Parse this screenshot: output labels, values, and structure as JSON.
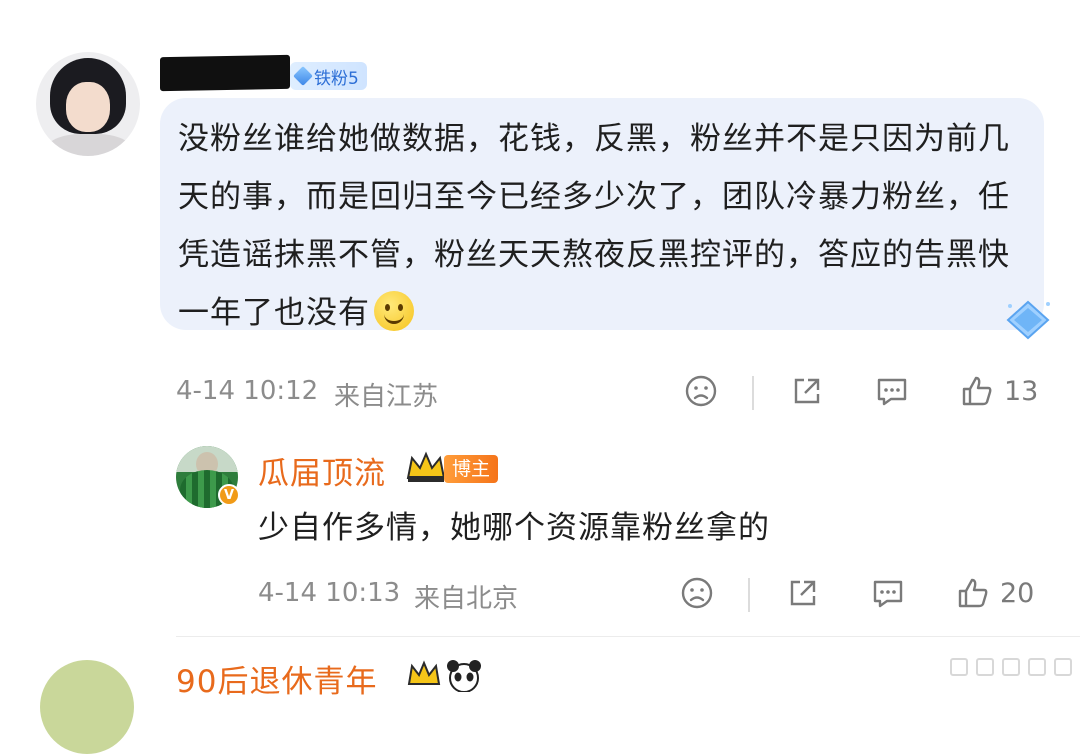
{
  "comment": {
    "badge_label": "铁粉5",
    "text": "没粉丝谁给她做数据，花钱，反黑，粉丝并不是只因为前几天的事，而是回归至今已经多少次了，团队冷暴力粉丝，任凭造谣抹黑不管，粉丝天天熬夜反黑控评的，答应的告黑快一年了也没有",
    "timestamp": "4-14 10:12",
    "location": "来自江苏",
    "like_count": "13"
  },
  "reply": {
    "username": "瓜届顶流",
    "role_badge": "博主",
    "text": "少自作多情，她哪个资源靠粉丝拿的",
    "timestamp": "4-14 10:13",
    "location": "来自北京",
    "like_count": "20"
  },
  "next_comment": {
    "username": "90后退休青年"
  },
  "icons": {
    "dislike": "sad-face-icon",
    "share": "share-icon",
    "comment": "comment-icon",
    "like": "thumbs-up-icon"
  },
  "colors": {
    "username_orange": "#e86a1c",
    "bubble_bg": "#ecf1fb",
    "fan_badge_text": "#2d6fd6",
    "meta_gray": "#8c8c8c"
  }
}
